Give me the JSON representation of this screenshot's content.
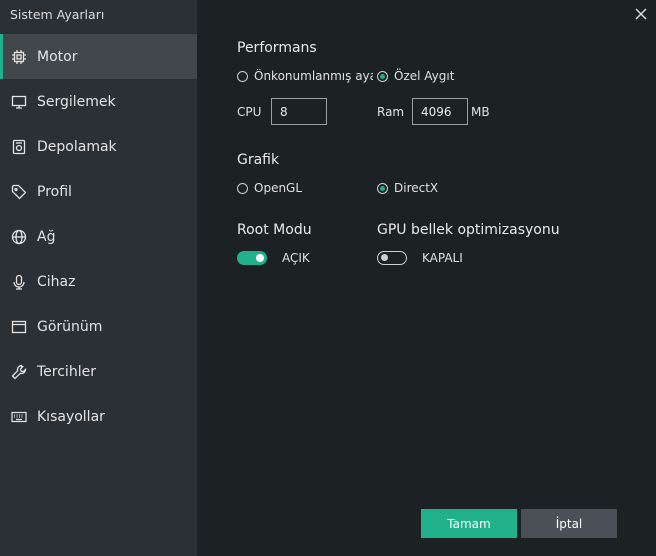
{
  "window": {
    "title": "Sistem Ayarları",
    "accent": "#20b08a"
  },
  "sidebar": {
    "items": [
      {
        "label": "Motor",
        "icon": "cpu-icon",
        "active": true
      },
      {
        "label": "Sergilemek",
        "icon": "monitor-icon"
      },
      {
        "label": "Depolamak",
        "icon": "storage-icon"
      },
      {
        "label": "Profil",
        "icon": "tag-icon"
      },
      {
        "label": "Ağ",
        "icon": "globe-icon"
      },
      {
        "label": "Cihaz",
        "icon": "microphone-icon"
      },
      {
        "label": "Görünüm",
        "icon": "window-icon"
      },
      {
        "label": "Tercihler",
        "icon": "wrench-icon"
      },
      {
        "label": "Kısayollar",
        "icon": "keyboard-icon"
      }
    ]
  },
  "performance": {
    "title": "Performans",
    "option_preset": "Önkonumlanmış ayarlar",
    "option_custom": "Özel Aygıt",
    "selected": "Özel Aygıt",
    "cpu_label": "CPU",
    "cpu_value": "8",
    "ram_label": "Ram",
    "ram_value": "4096",
    "ram_unit": "MB"
  },
  "graphics": {
    "title": "Grafik",
    "option_opengl": "OpenGL",
    "option_directx": "DirectX",
    "selected": "DirectX"
  },
  "root": {
    "title": "Root Modu",
    "state_label": "AÇIK",
    "enabled": true
  },
  "gpu": {
    "title": "GPU bellek optimizasyonu",
    "state_label": "KAPALI",
    "enabled": false
  },
  "footer": {
    "ok_label": "Tamam",
    "cancel_label": "İptal"
  }
}
